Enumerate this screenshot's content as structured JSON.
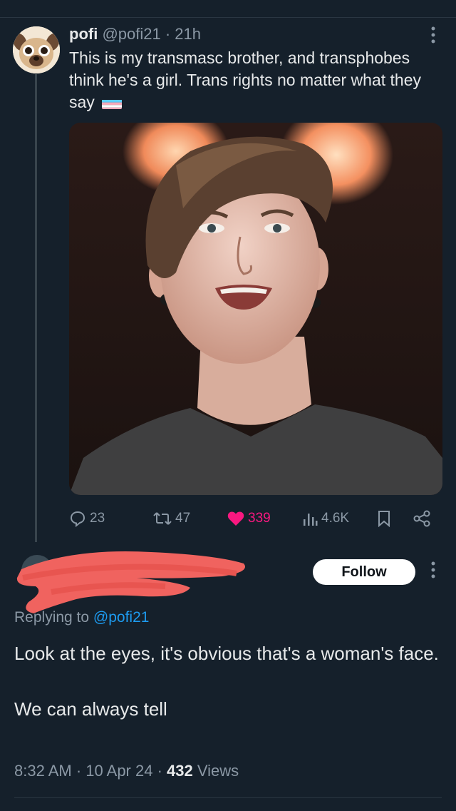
{
  "tweet": {
    "display_name": "pofi",
    "handle": "@pofi21",
    "separator": " · ",
    "time": "21h",
    "text": "This is my transmasc brother, and transphobes think he's a girl. Trans rights no matter what they say",
    "stats": {
      "replies": "23",
      "retweets": "47",
      "likes": "339",
      "views": "4.6K"
    }
  },
  "reply": {
    "follow_label": "Follow",
    "replying_prefix": "Replying to ",
    "replying_handle": "@pofi21",
    "paragraph1": "Look at the eyes, it's obvious that's a woman's face.",
    "paragraph2": "We can always tell",
    "time": "8:32 AM",
    "dot1": " · ",
    "date": "10 Apr 24",
    "dot2": " · ",
    "views_count": "432",
    "views_label": " Views"
  },
  "icons": [
    "pug-avatar",
    "more-icon",
    "reply-icon",
    "retweet-icon",
    "heart-icon",
    "views-icon",
    "bookmark-icon",
    "share-icon",
    "trans-flag"
  ],
  "colors": {
    "background": "#15202b",
    "like": "#f91880",
    "link": "#1d9bf0",
    "redaction": "#f0635f"
  }
}
